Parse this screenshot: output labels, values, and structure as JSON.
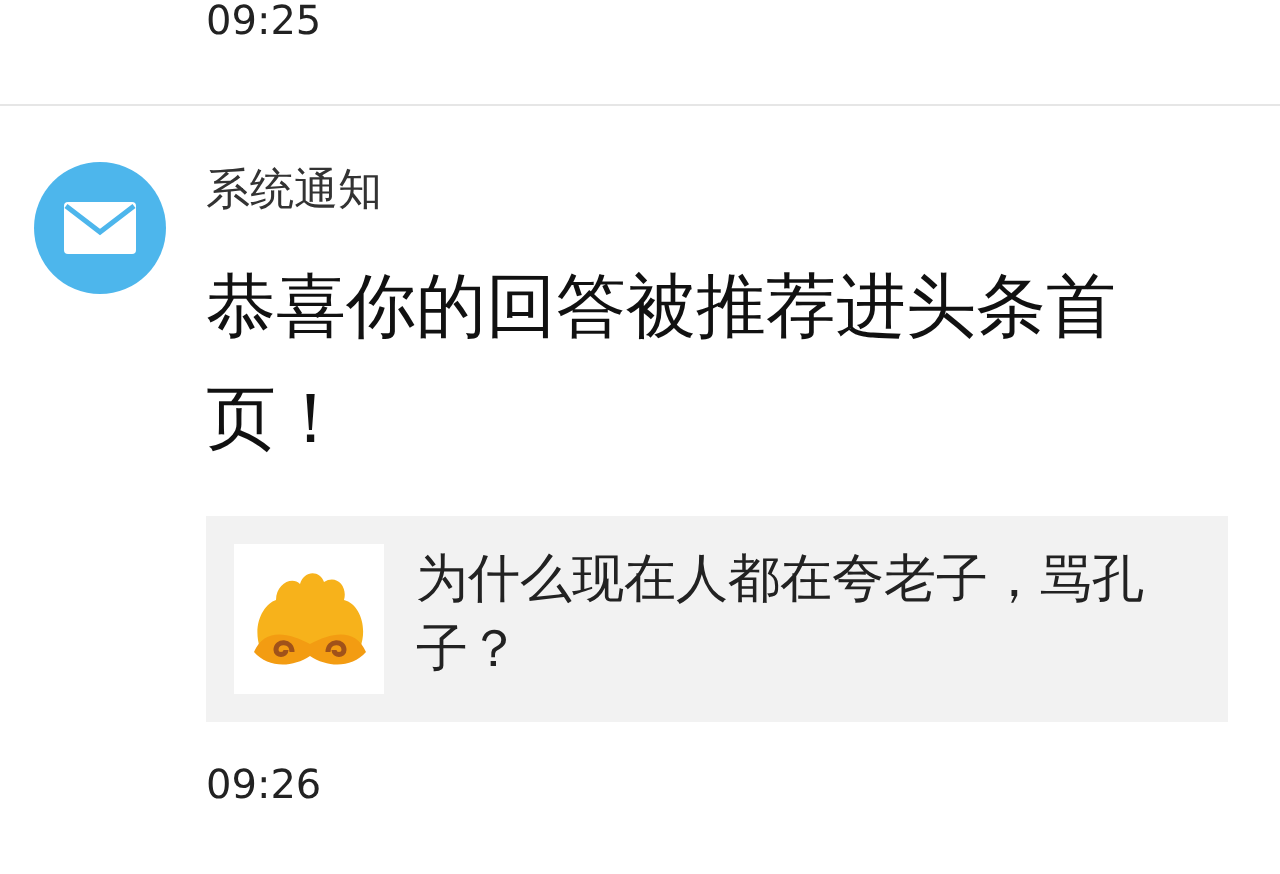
{
  "previous": {
    "time": "09:25"
  },
  "notification": {
    "sender": "系统通知",
    "message": "恭喜你的回答被推荐进头条首页！",
    "card": {
      "title": "为什么现在人都在夸老子，骂孔子？"
    },
    "time": "09:26"
  }
}
